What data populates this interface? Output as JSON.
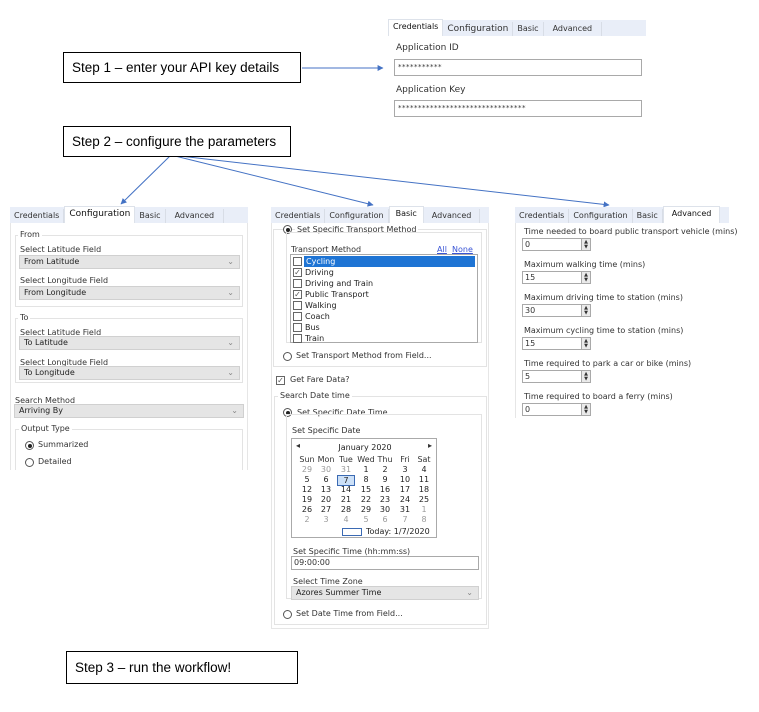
{
  "steps": {
    "step1": "Step 1 – enter your API key details",
    "step2": "Step 2 – configure the parameters",
    "step3": "Step 3 – run the workflow!"
  },
  "tabs": [
    "Credentials",
    "Configuration",
    "Basic",
    "Advanced"
  ],
  "credentials": {
    "app_id_label": "Application ID",
    "app_id_value": "***********",
    "app_key_label": "Application Key",
    "app_key_value": "********************************"
  },
  "configuration": {
    "from_group": "From",
    "from_lat_label": "Select Latitude Field",
    "from_lat_value": "From Latitude",
    "from_lon_label": "Select Longitude Field",
    "from_lon_value": "From Longitude",
    "to_group": "To",
    "to_lat_label": "Select Latitude Field",
    "to_lat_value": "To Latitude",
    "to_lon_label": "Select Longitude Field",
    "to_lon_value": "To Longitude",
    "search_method_label": "Search Method",
    "search_method_value": "Arriving By",
    "output_type_group": "Output Type",
    "output_options": [
      {
        "label": "Summarized",
        "selected": true
      },
      {
        "label": "Detailed",
        "selected": false
      }
    ]
  },
  "basic": {
    "specific_transport_label": "Set Specific Transport Method",
    "transport_method_label": "Transport Method",
    "all_link": "All",
    "none_link": "None",
    "transport_methods": [
      {
        "label": "Cycling",
        "checked": false,
        "highlighted": true
      },
      {
        "label": "Driving",
        "checked": true,
        "highlighted": false
      },
      {
        "label": "Driving and Train",
        "checked": false,
        "highlighted": false
      },
      {
        "label": "Public Transport",
        "checked": true,
        "highlighted": false
      },
      {
        "label": "Walking",
        "checked": false,
        "highlighted": false
      },
      {
        "label": "Coach",
        "checked": false,
        "highlighted": false
      },
      {
        "label": "Bus",
        "checked": false,
        "highlighted": false
      },
      {
        "label": "Train",
        "checked": false,
        "highlighted": false
      }
    ],
    "transport_from_field_label": "Set Transport Method from Field...",
    "get_fare_label": "Get Fare Data?",
    "get_fare_checked": true,
    "search_datetime_group": "Search Date time",
    "specific_datetime_label": "Set Specific Date Time",
    "specific_date_label": "Set Specific Date",
    "calendar": {
      "month_title": "January 2020",
      "prev": "◂",
      "next": "▸",
      "weekdays": [
        "Sun",
        "Mon",
        "Tue",
        "Wed",
        "Thu",
        "Fri",
        "Sat"
      ],
      "weeks": [
        [
          "29",
          "30",
          "31",
          "1",
          "2",
          "3",
          "4"
        ],
        [
          "5",
          "6",
          "7",
          "8",
          "9",
          "10",
          "11"
        ],
        [
          "12",
          "13",
          "14",
          "15",
          "16",
          "17",
          "18"
        ],
        [
          "19",
          "20",
          "21",
          "22",
          "23",
          "24",
          "25"
        ],
        [
          "26",
          "27",
          "28",
          "29",
          "30",
          "31",
          "1"
        ],
        [
          "2",
          "3",
          "4",
          "5",
          "6",
          "7",
          "8"
        ]
      ],
      "selected_day": "7",
      "today_label": "Today: 1/7/2020"
    },
    "specific_time_label": "Set Specific Time (hh:mm:ss)",
    "specific_time_value": "09:00:00",
    "time_zone_label": "Select Time Zone",
    "time_zone_value": "Azores Summer Time",
    "datetime_from_field_label": "Set Date Time from Field..."
  },
  "advanced": {
    "fields": [
      {
        "label": "Time needed to board public transport vehicle (mins)",
        "value": "0"
      },
      {
        "label": "Maximum walking time (mins)",
        "value": "15"
      },
      {
        "label": "Maximum driving time to station (mins)",
        "value": "30"
      },
      {
        "label": "Maximum cycling time to station (mins)",
        "value": "15"
      },
      {
        "label": "Time required to park a car or bike (mins)",
        "value": "5"
      },
      {
        "label": "Time required to board a ferry (mins)",
        "value": "0"
      }
    ]
  },
  "icons": {
    "chevron": "⌄",
    "check": "✓",
    "spin_up": "▲",
    "spin_down": "▼"
  },
  "colors": {
    "arrow": "#4472c4",
    "selection": "#1e74d4",
    "link": "#3a55d6"
  }
}
